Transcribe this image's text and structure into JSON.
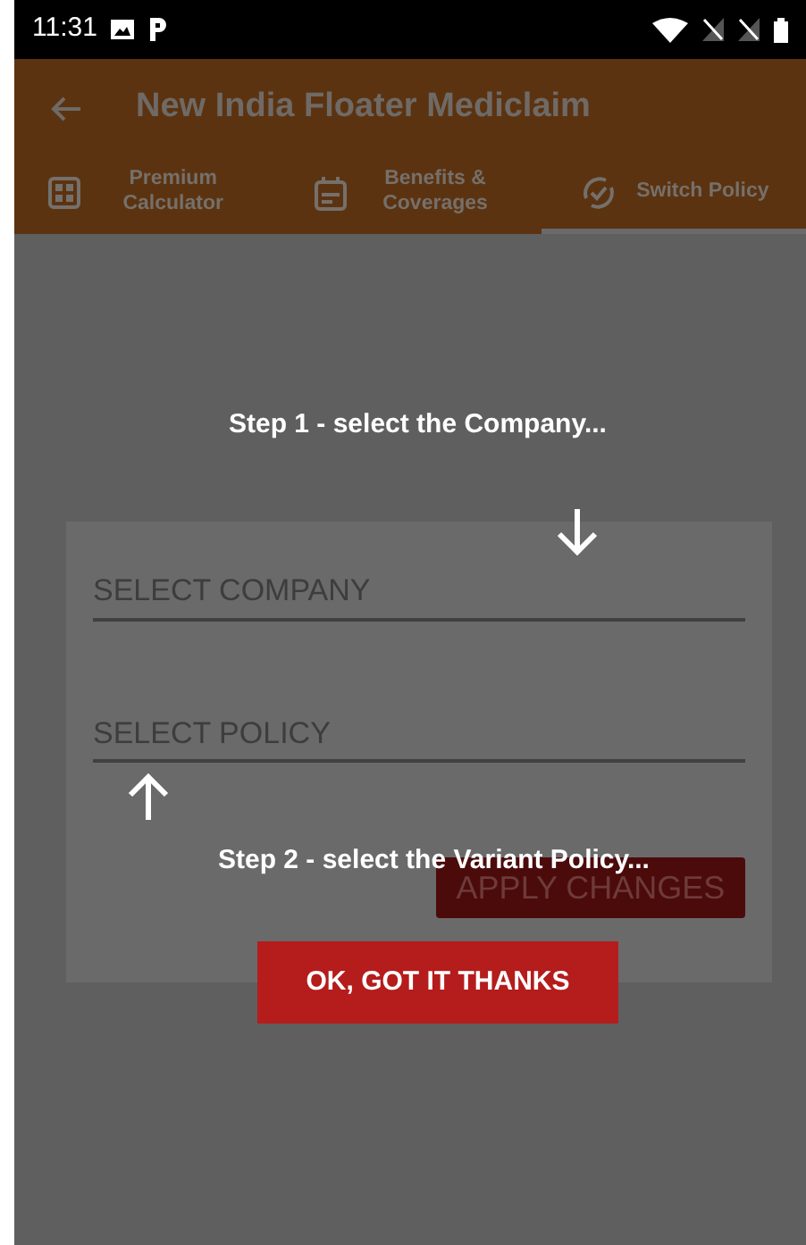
{
  "status_bar": {
    "time": "11:31"
  },
  "app_bar": {
    "title": "New India Floater Mediclaim"
  },
  "tabs": [
    {
      "label": "Premium Calculator",
      "kind": "calculator",
      "selected": false
    },
    {
      "label": "Benefits & Coverages",
      "kind": "calendar",
      "selected": false
    },
    {
      "label": "Switch Policy",
      "kind": "switch",
      "selected": true
    }
  ],
  "form": {
    "fields": [
      {
        "placeholder": "SELECT COMPANY"
      },
      {
        "placeholder": "SELECT POLICY"
      }
    ],
    "apply_button": "APPLY CHANGES"
  },
  "coach": {
    "steps": [
      {
        "text": "Step 1 - select the Company...",
        "kind": "down"
      },
      {
        "text": "Step 2 - select the Variant Policy...",
        "kind": "up"
      }
    ],
    "dismiss_button": "OK, GOT IT THANKS"
  }
}
